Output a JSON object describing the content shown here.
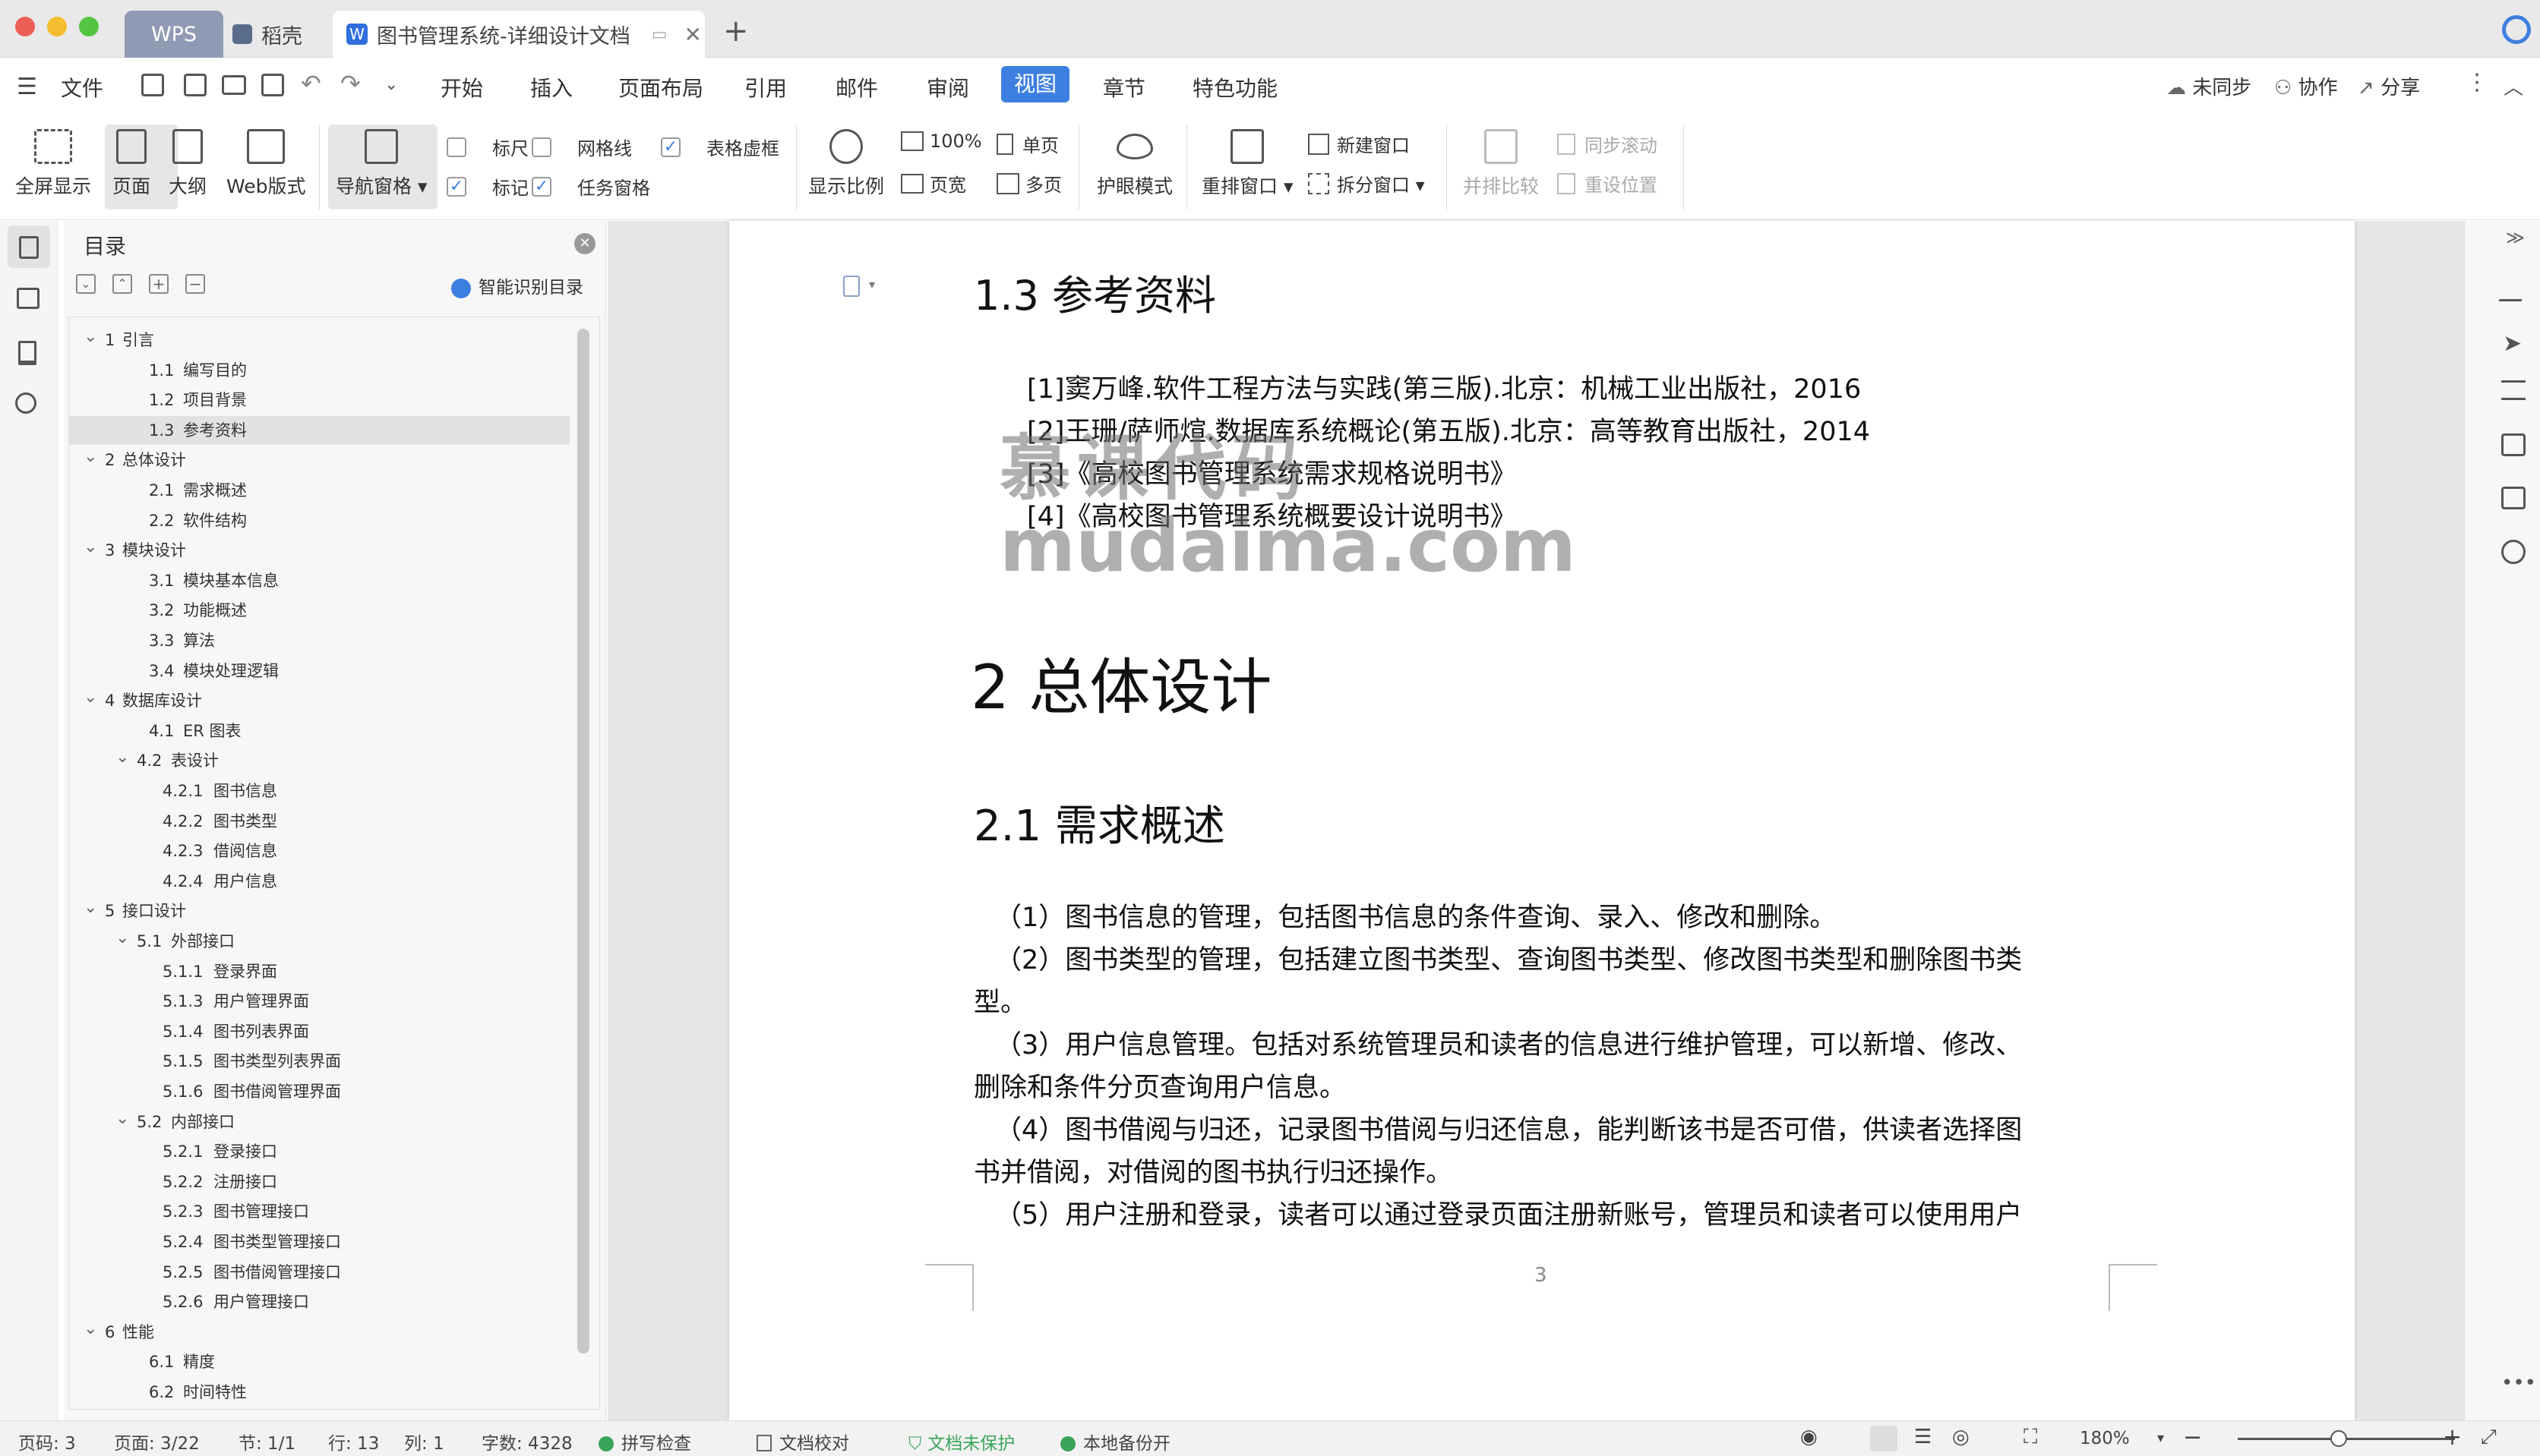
{
  "tabs": {
    "wps": "WPS",
    "daoke": "稻壳",
    "doc": "图书管理系统-详细设计文档"
  },
  "menu": {
    "file": "文件",
    "items": [
      "开始",
      "插入",
      "页面布局",
      "引用",
      "邮件",
      "审阅",
      "视图",
      "章节",
      "特色功能"
    ],
    "active": "视图",
    "unsynced": "未同步",
    "collab": "协作",
    "share": "分享"
  },
  "ribbon": {
    "fullscreen": "全屏显示",
    "page": "页面",
    "outline": "大纲",
    "web": "Web版式",
    "navpane": "导航窗格",
    "ruler": "标尺",
    "gridlines": "网格线",
    "table_gridlines": "表格虚框",
    "marks": "标记",
    "taskpane": "任务窗格",
    "zoom_ratio": "显示比例",
    "zoom100": "100%",
    "page_width": "页宽",
    "single_page": "单页",
    "multi_page": "多页",
    "eye_mode": "护眼模式",
    "rearrange": "重排窗口",
    "new_window": "新建窗口",
    "split_window": "拆分窗口",
    "side_by_side": "并排比较",
    "sync_scroll": "同步滚动",
    "reset_pos": "重设位置"
  },
  "nav": {
    "title": "目录",
    "smart_toc": "智能识别目录",
    "items": [
      {
        "num": "1",
        "text": "引言",
        "level": 1,
        "expand": true
      },
      {
        "num": "1.1",
        "text": "编写目的",
        "level": 2
      },
      {
        "num": "1.2",
        "text": "项目背景",
        "level": 2
      },
      {
        "num": "1.3",
        "text": "参考资料",
        "level": 2,
        "selected": true
      },
      {
        "num": "2",
        "text": "总体设计",
        "level": 1,
        "expand": true
      },
      {
        "num": "2.1",
        "text": "需求概述",
        "level": 2
      },
      {
        "num": "2.2",
        "text": "软件结构",
        "level": 2
      },
      {
        "num": "3",
        "text": "模块设计",
        "level": 1,
        "expand": true
      },
      {
        "num": "3.1",
        "text": "模块基本信息",
        "level": 2
      },
      {
        "num": "3.2",
        "text": "功能概述",
        "level": 2
      },
      {
        "num": "3.3",
        "text": "算法",
        "level": 2
      },
      {
        "num": "3.4",
        "text": "模块处理逻辑",
        "level": 2
      },
      {
        "num": "4",
        "text": "数据库设计",
        "level": 1,
        "expand": true
      },
      {
        "num": "4.1",
        "text": "ER 图表",
        "level": 2
      },
      {
        "num": "4.2",
        "text": "表设计",
        "level": 2,
        "expand": true
      },
      {
        "num": "4.2.1",
        "text": "图书信息",
        "level": 3
      },
      {
        "num": "4.2.2",
        "text": "图书类型",
        "level": 3
      },
      {
        "num": "4.2.3",
        "text": "借阅信息",
        "level": 3
      },
      {
        "num": "4.2.4",
        "text": "用户信息",
        "level": 3
      },
      {
        "num": "5",
        "text": "接口设计",
        "level": 1,
        "expand": true
      },
      {
        "num": "5.1",
        "text": "外部接口",
        "level": 2,
        "expand": true
      },
      {
        "num": "5.1.1",
        "text": "登录界面",
        "level": 3
      },
      {
        "num": "5.1.3",
        "text": "用户管理界面",
        "level": 3
      },
      {
        "num": "5.1.4",
        "text": "图书列表界面",
        "level": 3
      },
      {
        "num": "5.1.5",
        "text": "图书类型列表界面",
        "level": 3
      },
      {
        "num": "5.1.6",
        "text": "图书借阅管理界面",
        "level": 3
      },
      {
        "num": "5.2",
        "text": "内部接口",
        "level": 2,
        "expand": true
      },
      {
        "num": "5.2.1",
        "text": "登录接口",
        "level": 3
      },
      {
        "num": "5.2.2",
        "text": "注册接口",
        "level": 3
      },
      {
        "num": "5.2.3",
        "text": "图书管理接口",
        "level": 3
      },
      {
        "num": "5.2.4",
        "text": "图书类型管理接口",
        "level": 3
      },
      {
        "num": "5.2.5",
        "text": "图书借阅管理接口",
        "level": 3
      },
      {
        "num": "5.2.6",
        "text": "用户管理接口",
        "level": 3
      },
      {
        "num": "6",
        "text": "性能",
        "level": 1,
        "expand": true
      },
      {
        "num": "6.1",
        "text": "精度",
        "level": 2
      },
      {
        "num": "6.2",
        "text": "时间特性",
        "level": 2
      }
    ]
  },
  "doc": {
    "h_refs": "1.3  参考资料",
    "refs": [
      "[1]窦万峰.软件工程方法与实践(第三版).北京：机械工业出版社，2016",
      "[2]王珊/萨师煊.数据库系统概论(第五版).北京：高等教育出版社，2014",
      "[3]《高校图书管理系统需求规格说明书》",
      "[4]《高校图书管理系统概要设计说明书》"
    ],
    "h2": "2  总体设计",
    "h21": "2.1  需求概述",
    "lines": [
      "（1）图书信息的管理，包括图书信息的条件查询、录入、修改和删除。",
      "（2）图书类型的管理，包括建立图书类型、查询图书类型、修改图书类型和删除图书类",
      "型。",
      "（3）用户信息管理。包括对系统管理员和读者的信息进行维护管理，可以新增、修改、",
      "删除和条件分页查询用户信息。",
      "（4）图书借阅与归还，记录图书借阅与归还信息，能判断该书是否可借，供读者选择图",
      "书并借阅，对借阅的图书执行归还操作。",
      "（5）用户注册和登录，读者可以通过登录页面注册新账号，管理员和读者可以使用用户"
    ],
    "page_no": "3",
    "watermark_line1": "慕课代码",
    "watermark_line2": "mudaima.com"
  },
  "status": {
    "page_code": "页码: 3",
    "pages": "页面: 3/22",
    "section": "节: 1/1",
    "row": "行: 13",
    "col": "列: 1",
    "words": "字数: 4328",
    "spell": "拼写检查",
    "proof": "文档校对",
    "protect": "文档未保护",
    "backup": "本地备份开",
    "zoom": "180%"
  },
  "colors": {
    "accent": "#3d7fe0",
    "active_tab": "#3d7fe0"
  }
}
